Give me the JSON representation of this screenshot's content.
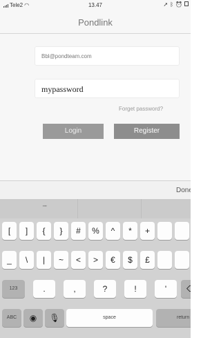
{
  "status_bar": {
    "carrier": "Tele2",
    "time": "13.47"
  },
  "nav": {
    "title": "Pondlink"
  },
  "form": {
    "email_value": "Bbl@pondteam.com",
    "password_value": "mypassword",
    "forgot_label": "Forget password?",
    "login_label": "Login",
    "register_label": "Register"
  },
  "accessory": {
    "done_label": "Done"
  },
  "keyboard": {
    "prediction": "\"\"",
    "row1": [
      "[",
      "]",
      "{",
      "}",
      "#",
      "%",
      "^",
      "*",
      "+"
    ],
    "row2": [
      "_",
      "\\",
      "|",
      "~",
      "<",
      ">",
      "€",
      "$",
      "£"
    ],
    "row3": [
      "123",
      ".",
      ",",
      "?",
      "!",
      "'"
    ],
    "row4": [
      "ABC",
      "space",
      "return"
    ]
  }
}
